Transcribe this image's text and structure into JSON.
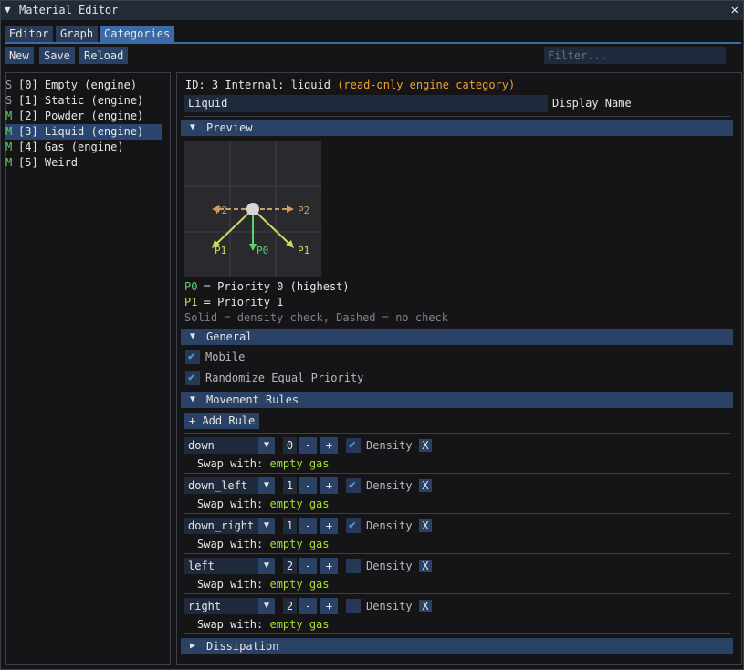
{
  "window": {
    "title": "Material Editor",
    "collapse_glyph": "▼",
    "close_glyph": "✕"
  },
  "tabs": [
    {
      "label": "Editor"
    },
    {
      "label": "Graph"
    },
    {
      "label": "Categories"
    }
  ],
  "toolbar": {
    "new_label": "New",
    "save_label": "Save",
    "reload_label": "Reload",
    "filter_placeholder": "Filter..."
  },
  "categories": [
    {
      "tag": "S",
      "label": "[0] Empty (engine)"
    },
    {
      "tag": "S",
      "label": "[1] Static (engine)"
    },
    {
      "tag": "M",
      "label": "[2] Powder (engine)"
    },
    {
      "tag": "M",
      "label": "[3] Liquid (engine)"
    },
    {
      "tag": "M",
      "label": "[4] Gas (engine)"
    },
    {
      "tag": "M",
      "label": "[5] Weird"
    }
  ],
  "detail": {
    "id_text": "ID: 3 Internal: liquid",
    "readonly_note": "(read-only engine category)",
    "display_name_value": "Liquid",
    "display_name_label": "Display Name"
  },
  "preview": {
    "header": "Preview",
    "diagram_labels": {
      "p2_left": "P2",
      "p2_right": "P2",
      "p1_left": "P1",
      "p0": "P0",
      "p1_right": "P1"
    },
    "legend_p0_key": "P0",
    "legend_p0_text": " = Priority 0 (highest)",
    "legend_p1_key": "P1",
    "legend_p1_text": " = Priority 1",
    "legend_note": "Solid = density check, Dashed = no check"
  },
  "general": {
    "header": "General",
    "mobile_label": "Mobile",
    "randomize_label": "Randomize Equal Priority"
  },
  "movement": {
    "header": "Movement Rules",
    "add_rule_label": "+ Add Rule",
    "density_label": "Density",
    "swap_label": "Swap with:",
    "swap_values": "empty gas",
    "minus": "-",
    "plus": "+",
    "remove": "X",
    "rules": [
      {
        "direction": "down",
        "priority": "0",
        "density": true
      },
      {
        "direction": "down_left",
        "priority": "1",
        "density": true
      },
      {
        "direction": "down_right",
        "priority": "1",
        "density": true
      },
      {
        "direction": "left",
        "priority": "2",
        "density": false
      },
      {
        "direction": "right",
        "priority": "2",
        "density": false
      }
    ]
  },
  "dissipation": {
    "header": "Dissipation"
  },
  "colors": {
    "header_bg": "#2a4266",
    "active_tab": "#3a6aa8",
    "movable_tag": "#5fd06a",
    "priority0": "#5fd06a",
    "priority1": "#c8dc60",
    "priority2": "#d09a60",
    "readonly_note": "#f0a030",
    "swap_values": "#a6e22e"
  }
}
